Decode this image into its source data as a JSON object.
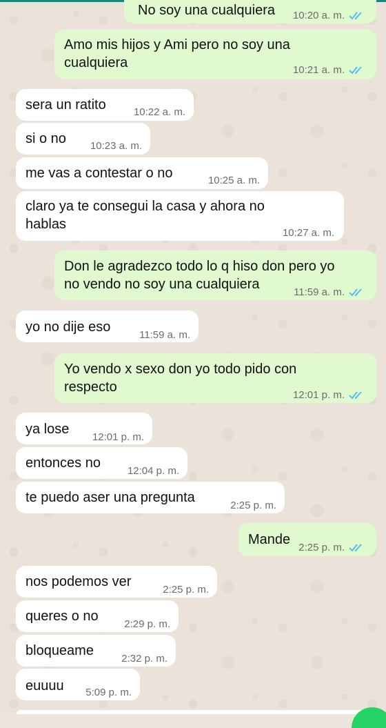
{
  "messages": [
    {
      "id": "m1",
      "dir": "out",
      "text": "No soy una cualquiera",
      "time": "10:20 a. m."
    },
    {
      "id": "m2",
      "dir": "out",
      "text": "Amo mis hijos y Ami pero no soy una\ncualquiera",
      "time": "10:21 a. m."
    },
    {
      "id": "m3",
      "dir": "in",
      "text": "sera un ratito",
      "time": "10:22 a. m."
    },
    {
      "id": "m4",
      "dir": "in",
      "text": "si o no",
      "time": "10:23 a. m."
    },
    {
      "id": "m5",
      "dir": "in",
      "text": "me vas a contestar o no",
      "time": "10:25 a. m."
    },
    {
      "id": "m6",
      "dir": "in",
      "text": "claro ya te consegui la casa y ahora no\nhablas",
      "time": "10:27 a. m."
    },
    {
      "id": "m7",
      "dir": "out",
      "text": "Don le agradezco todo lo q hiso don pero yo\nno vendo no soy una cualquiera",
      "time": "11:59 a. m."
    },
    {
      "id": "m8",
      "dir": "in",
      "text": "yo no dije eso",
      "time": "11:59 a. m."
    },
    {
      "id": "m9",
      "dir": "out",
      "text": "Yo vendo x sexo don yo todo pido con\nrespecto",
      "time": "12:01 p. m."
    },
    {
      "id": "m10",
      "dir": "in",
      "text": "ya lose",
      "time": "12:01 p. m."
    },
    {
      "id": "m11",
      "dir": "in",
      "text": "entonces no",
      "time": "12:04 p. m."
    },
    {
      "id": "m12",
      "dir": "in",
      "text": "te puedo aser una pregunta",
      "time": "2:25 p. m."
    },
    {
      "id": "m13",
      "dir": "out",
      "text": "Mande",
      "time": "2:25 p. m."
    },
    {
      "id": "m14",
      "dir": "in",
      "text": "nos podemos ver",
      "time": "2:25 p. m."
    },
    {
      "id": "m15",
      "dir": "in",
      "text": "queres o no",
      "time": "2:29 p. m."
    },
    {
      "id": "m16",
      "dir": "in",
      "text": "bloqueame",
      "time": "2:32 p. m."
    },
    {
      "id": "m17",
      "dir": "in",
      "text": "euuuu",
      "time": "5:09 p. m."
    }
  ],
  "colors": {
    "outgoing": "#e1f9cf",
    "incoming": "#ffffff",
    "read_ticks": "#53bdeb",
    "accent": "#25d366"
  },
  "icons": {
    "read": "double-check-icon"
  }
}
